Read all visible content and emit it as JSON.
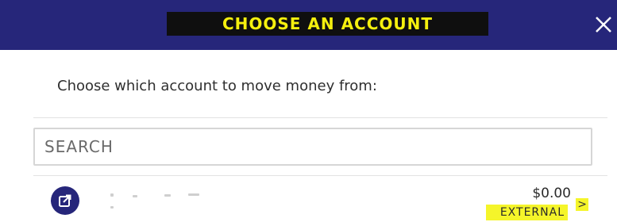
{
  "header": {
    "title": "CHOOSE AN ACCOUNT",
    "close_icon": "close-icon",
    "background_color": "#26267a",
    "title_color": "#f5f00e"
  },
  "prompt": "Choose which account to move money from:",
  "search": {
    "placeholder": "SEARCH",
    "value": ""
  },
  "accounts": [
    {
      "icon": "external-link-icon",
      "balance": "$0.00",
      "type": "EXTERNAL",
      "chevron": ">"
    }
  ]
}
